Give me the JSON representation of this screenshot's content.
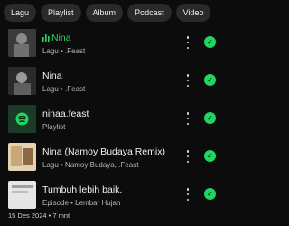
{
  "filters": [
    "Lagu",
    "Playlist",
    "Album",
    "Podcast",
    "Video"
  ],
  "items": [
    {
      "title": "Nina",
      "subtitle": "Lagu • .Feast",
      "playing": true,
      "thumb_color": "#6f6f6f"
    },
    {
      "title": "Nina",
      "subtitle": "Lagu • .Feast",
      "playing": false,
      "thumb_color": "#5b5b5b"
    },
    {
      "title": "ninaa.feast",
      "subtitle": "Playlist",
      "playing": false,
      "thumb_color": "#1f4a32"
    },
    {
      "title": "Nina (Namoy Budaya Remix)",
      "subtitle": "Lagu • Namoy Budaya, .Feast",
      "playing": false,
      "thumb_color": "#d9c7a8"
    },
    {
      "title": "Tumbuh lebih baik.",
      "subtitle": "Episode • Lembar Hujan",
      "playing": false,
      "thumb_color": "#dadada"
    }
  ],
  "episode_meta": "15 Des 2024 • 7 mnt",
  "colors": {
    "accent": "#1ed760",
    "playing_text": "#2fd45f",
    "background": "#0c0c0c",
    "chip": "#2a2a2a"
  },
  "icons": {
    "downloaded": "downloaded-check-icon",
    "more": "more-options-icon",
    "playing": "equalizer-icon"
  }
}
